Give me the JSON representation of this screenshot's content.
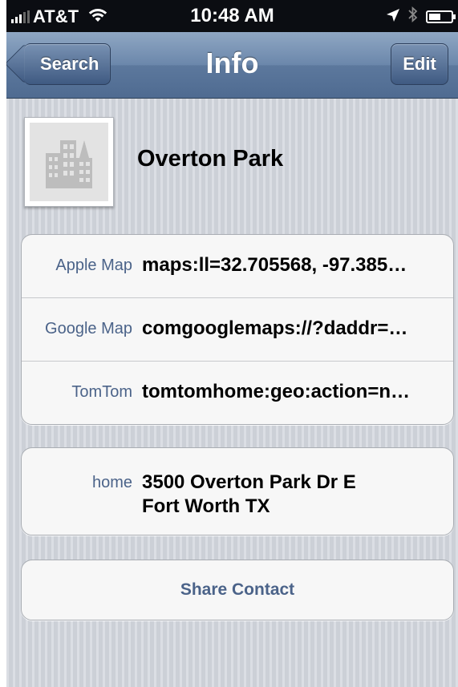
{
  "status_bar": {
    "carrier": "AT&T",
    "time": "10:48 AM"
  },
  "nav": {
    "back_label": "Search",
    "title": "Info",
    "edit_label": "Edit"
  },
  "contact": {
    "name": "Overton Park",
    "avatar_icon": "building-icon"
  },
  "urls": [
    {
      "label": "Apple Map",
      "value": "maps:ll=32.705568, -97.385…"
    },
    {
      "label": "Google Map",
      "value": "comgooglemaps://?daddr=…"
    },
    {
      "label": "TomTom",
      "value": "tomtomhome:geo:action=n…"
    }
  ],
  "address": {
    "label": "home",
    "line1": "3500 Overton Park Dr E",
    "line2": "Fort Worth TX"
  },
  "share": {
    "label": "Share Contact"
  },
  "colors": {
    "nav_bar": "#6b87ab",
    "label_blue": "#4b6389",
    "background": "#d3d7de"
  }
}
